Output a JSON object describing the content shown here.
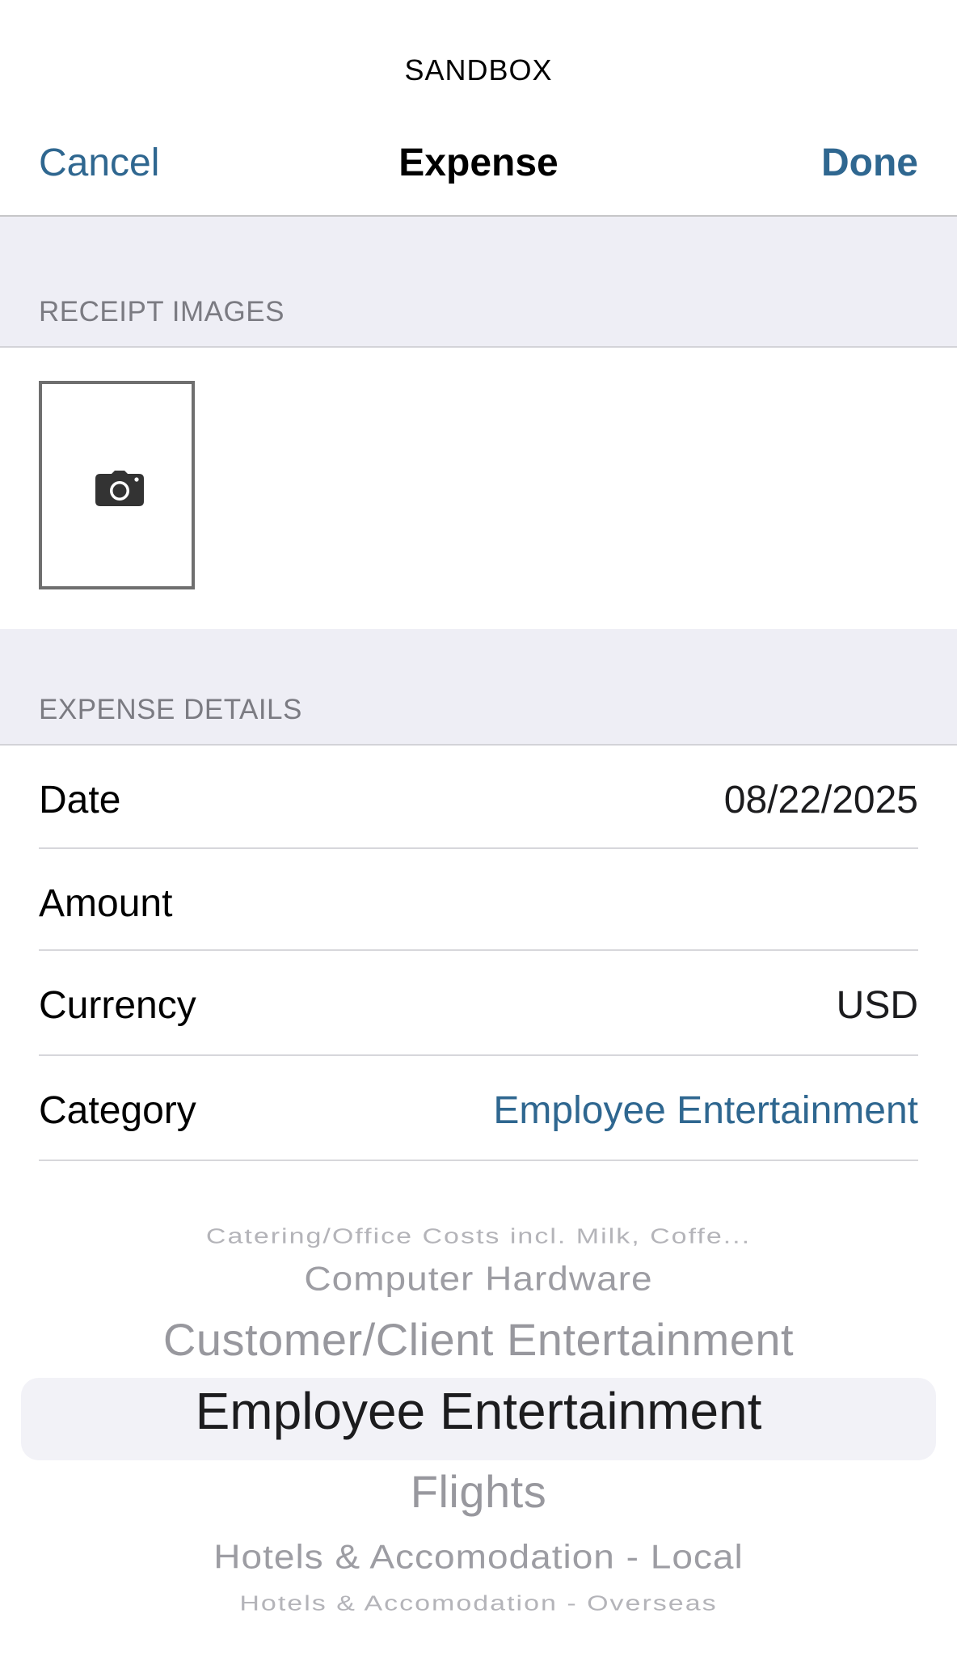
{
  "environment_label": "SANDBOX",
  "nav": {
    "cancel_label": "Cancel",
    "title": "Expense",
    "done_label": "Done"
  },
  "receipt_section": {
    "header": "RECEIPT IMAGES",
    "add_photo_icon": "camera-icon"
  },
  "details_section": {
    "header": "EXPENSE DETAILS",
    "rows": [
      {
        "label": "Date",
        "value": "08/22/2025"
      },
      {
        "label": "Amount",
        "value": ""
      },
      {
        "label": "Currency",
        "value": "USD"
      },
      {
        "label": "Category",
        "value": "Employee Entertainment"
      }
    ]
  },
  "category_picker": {
    "items": [
      "Catering/Office Costs incl. Milk, Coffe...",
      "Computer Hardware",
      "Customer/Client Entertainment",
      "Employee Entertainment",
      "Flights",
      "Hotels & Accomodation - Local",
      "Hotels & Accomodation - Overseas"
    ],
    "selected": "Employee Entertainment"
  },
  "colors": {
    "accent": "#2f6790",
    "section_background": "#eeeef5",
    "section_text": "#7b7b82",
    "picker_selection_background": "#f2f2f7"
  }
}
